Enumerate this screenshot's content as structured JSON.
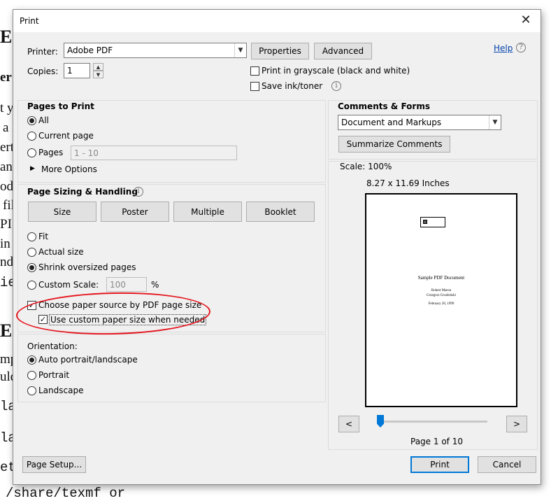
{
  "background_document": {
    "lines": [
      "E",
      "er",
      "t y",
      "a",
      "ert",
      "an",
      "od",
      "fil",
      "PI",
      "in",
      "ndo",
      "ie",
      "E",
      "mp",
      "uld",
      "la",
      "la",
      "et"
    ],
    "bottom_text": "/share/texmf or"
  },
  "dialog": {
    "title": "Print",
    "close_icon": "close-icon",
    "printer_label": "Printer:",
    "printer_value": "Adobe PDF",
    "properties_label": "Properties",
    "advanced_label": "Advanced",
    "help_label": "Help",
    "copies_label": "Copies:",
    "copies_value": "1",
    "grayscale_label": "Print in grayscale (black and white)",
    "grayscale_checked": false,
    "save_ink_label": "Save ink/toner",
    "save_ink_checked": false
  },
  "pages_to_print": {
    "title": "Pages to Print",
    "all_label": "All",
    "current_label": "Current page",
    "pages_label": "Pages",
    "pages_value": "1 - 10",
    "selected": "All",
    "more_options_label": "More Options"
  },
  "page_sizing": {
    "title": "Page Sizing & Handling",
    "buttons": [
      "Size",
      "Poster",
      "Multiple",
      "Booklet"
    ],
    "fit_label": "Fit",
    "actual_size_label": "Actual size",
    "shrink_label": "Shrink oversized pages",
    "custom_scale_label": "Custom Scale:",
    "custom_scale_value": "100",
    "percent": "%",
    "selected": "Shrink oversized pages",
    "choose_paper_label": "Choose paper source by PDF page size",
    "choose_paper_checked": true,
    "custom_paper_label": "Use custom paper size when needed",
    "custom_paper_checked": true
  },
  "orientation": {
    "title": "Orientation:",
    "options": [
      "Auto portrait/landscape",
      "Portrait",
      "Landscape"
    ],
    "selected": "Auto portrait/landscape"
  },
  "comments_forms": {
    "title": "Comments & Forms",
    "value": "Document and Markups",
    "summarize_label": "Summarize Comments"
  },
  "preview": {
    "scale_label": "Scale: 100%",
    "dimensions": "8.27 x 11.69 Inches",
    "doc_title": "Sample PDF Document",
    "authors": [
      "Robert Maron",
      "Grzegorz Grudziński"
    ],
    "date": "February 20, 1999",
    "prev_label": "<",
    "next_label": ">",
    "slider_fraction": 0.0,
    "page_indicator": "Page 1 of 10"
  },
  "footer": {
    "page_setup_label": "Page Setup...",
    "print_label": "Print",
    "cancel_label": "Cancel"
  },
  "colors": {
    "annotation_ellipse": "#e4161f",
    "accent": "#0078d7",
    "link": "#0645ad"
  }
}
